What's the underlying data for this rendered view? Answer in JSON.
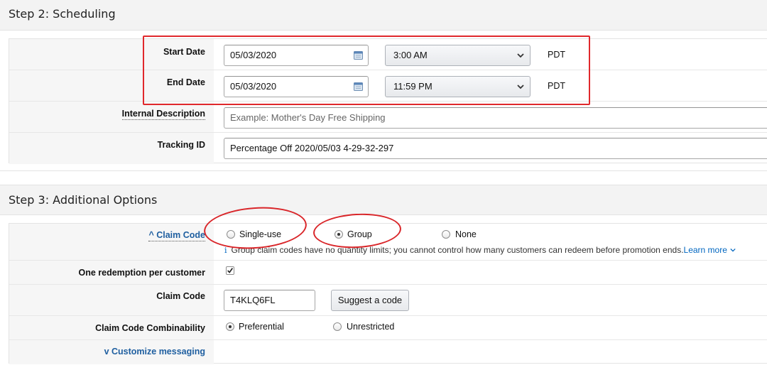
{
  "step2": {
    "title": "Step 2: Scheduling",
    "start_date": {
      "label": "Start Date",
      "date": "05/03/2020",
      "time": "3:00 AM",
      "tz": "PDT"
    },
    "end_date": {
      "label": "End Date",
      "date": "05/03/2020",
      "time": "11:59 PM",
      "tz": "PDT"
    },
    "internal_description": {
      "label": "Internal Description",
      "placeholder": "Example: Mother's Day Free Shipping"
    },
    "tracking_id": {
      "label": "Tracking ID",
      "value": "Percentage Off 2020/05/03 4-29-32-297"
    }
  },
  "step3": {
    "title": "Step 3: Additional Options",
    "claim_code_type": {
      "caret": "^",
      "label": "Claim Code",
      "options": [
        "Single-use",
        "Group",
        "None"
      ],
      "selected": "Group",
      "info_icon": "i",
      "info_text": "Group claim codes have no quantity limits; you cannot control how many customers can redeem before promotion ends.",
      "learn_more": "Learn more"
    },
    "one_redemption": {
      "label": "One redemption per customer",
      "checked": true
    },
    "claim_code": {
      "label": "Claim Code",
      "value": "T4KLQ6FL",
      "suggest_button": "Suggest a code"
    },
    "combinability": {
      "label": "Claim Code Combinability",
      "options": [
        "Preferential",
        "Unrestricted"
      ],
      "selected": "Preferential"
    },
    "customize": {
      "caret": "v",
      "label": "Customize messaging"
    }
  },
  "colors": {
    "link": "#0066c0",
    "annotation": "#e0282c",
    "label_bg": "#f6f6f6",
    "header_bg": "#f3f3f3"
  },
  "icons": [
    "calendar-icon",
    "chevron-down-icon",
    "info-icon",
    "checkmark-icon"
  ]
}
